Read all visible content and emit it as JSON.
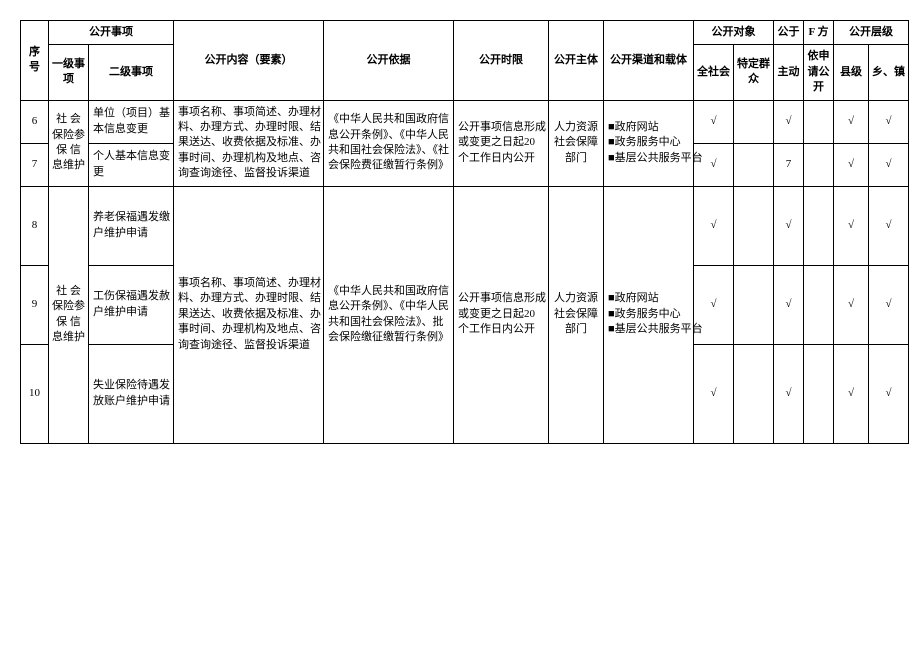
{
  "headers": {
    "seq": "序 号",
    "matter": "公开事项",
    "l1": "一级事项",
    "l2": "二级事项",
    "content": "公开内容（要素）",
    "basis": "公开依据",
    "time": "公开时限",
    "subject": "公开主体",
    "channel": "公开渠道和载体",
    "target": "公开对象",
    "all": "全社会",
    "specific": "特定群众",
    "method_a": "公于",
    "method_b": "F 方",
    "active": "主动",
    "apply": "依申请公开",
    "level": "公开层级",
    "county": "县级",
    "town": "乡、镇"
  },
  "groups": [
    {
      "rows": [
        {
          "seq": "6",
          "l2": "单位（项目）基本信息变更",
          "all": "√",
          "spec": "",
          "active": "√",
          "apply": "",
          "county": "√",
          "town": "√"
        },
        {
          "seq": "7",
          "l2": "个人基本信息变更",
          "all": "√",
          "spec": "",
          "active": "7",
          "apply": "",
          "county": "√",
          "town": "√"
        }
      ],
      "l1": "社 会 保险参 保 信息维护",
      "content": "事项名称、事项简述、办理材料、办理方式、办理时限、结果送达、收费依据及标准、办事时间、办理机构及地点、咨询查询途径、监督投诉渠道",
      "basis": "《中华人民共和国政府信息公开条例》、《中华人民共和国社会保险法》、《社会保险费征缴暂行条例》",
      "time": "公开事项信息形成或变更之日起20 个工作日内公开",
      "subject": "人力资源社会保障部门",
      "channel_items": [
        "■政府网站",
        "■政务服务中心",
        "■基层公共服务平台"
      ]
    },
    {
      "rows": [
        {
          "seq": "8",
          "l2": "养老保福遇发缴户维护申请",
          "all": "√",
          "spec": "",
          "active": "√",
          "apply": "",
          "county": "√",
          "town": "√"
        },
        {
          "seq": "9",
          "l2": "工伤保福遇发赦户维护申请",
          "all": "√",
          "spec": "",
          "active": "√",
          "apply": "",
          "county": "√",
          "town": "√"
        },
        {
          "seq": "10",
          "l2": "失业保险待遇发放账户维护申请",
          "all": "√",
          "spec": "",
          "active": "√",
          "apply": "",
          "county": "√",
          "town": "√"
        }
      ],
      "l1": "社 会 保险参 保 信息维护",
      "content": "事项名称、事项简述、办理材料、办理方式、办理时限、结果送达、收费依据及标准、办事时间、办理机构及地点、咨询查询途径、监督投诉渠道",
      "basis": "《中华人民共和国政府信息公开条例》、《中华人民共和国社会保险法》、批会保险缴征缴暂行条例》",
      "time": "公开事项信息形成或变更之日起20 个工作日内公开",
      "subject": "人力资源社会保障部门",
      "channel_items": [
        "■政府网站",
        "■政务服务中心",
        "■基层公共服务平台"
      ]
    }
  ]
}
